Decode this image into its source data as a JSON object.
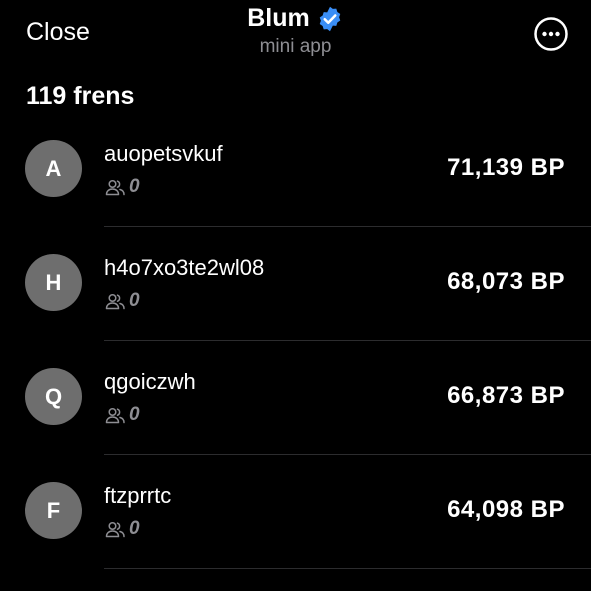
{
  "header": {
    "close_label": "Close",
    "title": "Blum",
    "subtitle": "mini app",
    "verified_icon": "verified-badge-icon",
    "more_icon": "more-options-icon",
    "accent_color": "#3a8ef6"
  },
  "summary": {
    "count_label": "119 frens"
  },
  "friends": [
    {
      "initial": "A",
      "name": "auopetsvkuf",
      "frens": "0",
      "points": "71,139 BP"
    },
    {
      "initial": "H",
      "name": "h4o7xo3te2wl08",
      "frens": "0",
      "points": "68,073 BP"
    },
    {
      "initial": "Q",
      "name": "qgoiczwh",
      "frens": "0",
      "points": "66,873 BP"
    },
    {
      "initial": "F",
      "name": "ftzprrtc",
      "frens": "0",
      "points": "64,098 BP"
    }
  ]
}
